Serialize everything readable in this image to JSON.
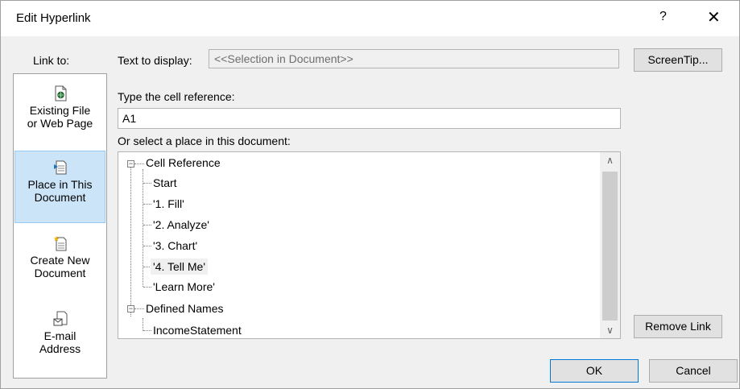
{
  "window": {
    "title": "Edit Hyperlink",
    "help": "?",
    "close": "✕"
  },
  "link_to": {
    "label": "Link to:",
    "items": [
      {
        "label": "Existing File\nor Web Page",
        "icon": "existing-file-icon",
        "selected": false
      },
      {
        "label": "Place in This\nDocument",
        "icon": "place-in-document-icon",
        "selected": true
      },
      {
        "label": "Create New\nDocument",
        "icon": "create-new-document-icon",
        "selected": false
      },
      {
        "label": "E-mail\nAddress",
        "icon": "email-address-icon",
        "selected": false
      }
    ]
  },
  "text_to_display": {
    "label": "Text to display:",
    "value": "<<Selection in Document>>"
  },
  "screentip_button": "ScreenTip...",
  "cell_reference": {
    "label": "Type the cell reference:",
    "value": "A1"
  },
  "place": {
    "label": "Or select a place in this document:",
    "groups": [
      {
        "label": "Cell Reference",
        "expanded": true,
        "items": [
          "Start",
          "'1. Fill'",
          "'2. Analyze'",
          "'3. Chart'",
          "'4. Tell Me'",
          "'Learn More'"
        ]
      },
      {
        "label": "Defined Names",
        "expanded": true,
        "items": [
          "IncomeStatement"
        ]
      }
    ],
    "highlighted_item": "'4. Tell Me'"
  },
  "remove_link_button": "Remove Link",
  "ok_button": "OK",
  "cancel_button": "Cancel",
  "colors": {
    "selected_bg": "#cce4f7",
    "dialog_bg": "#f0f0f0",
    "default_button_border": "#0078d7"
  }
}
